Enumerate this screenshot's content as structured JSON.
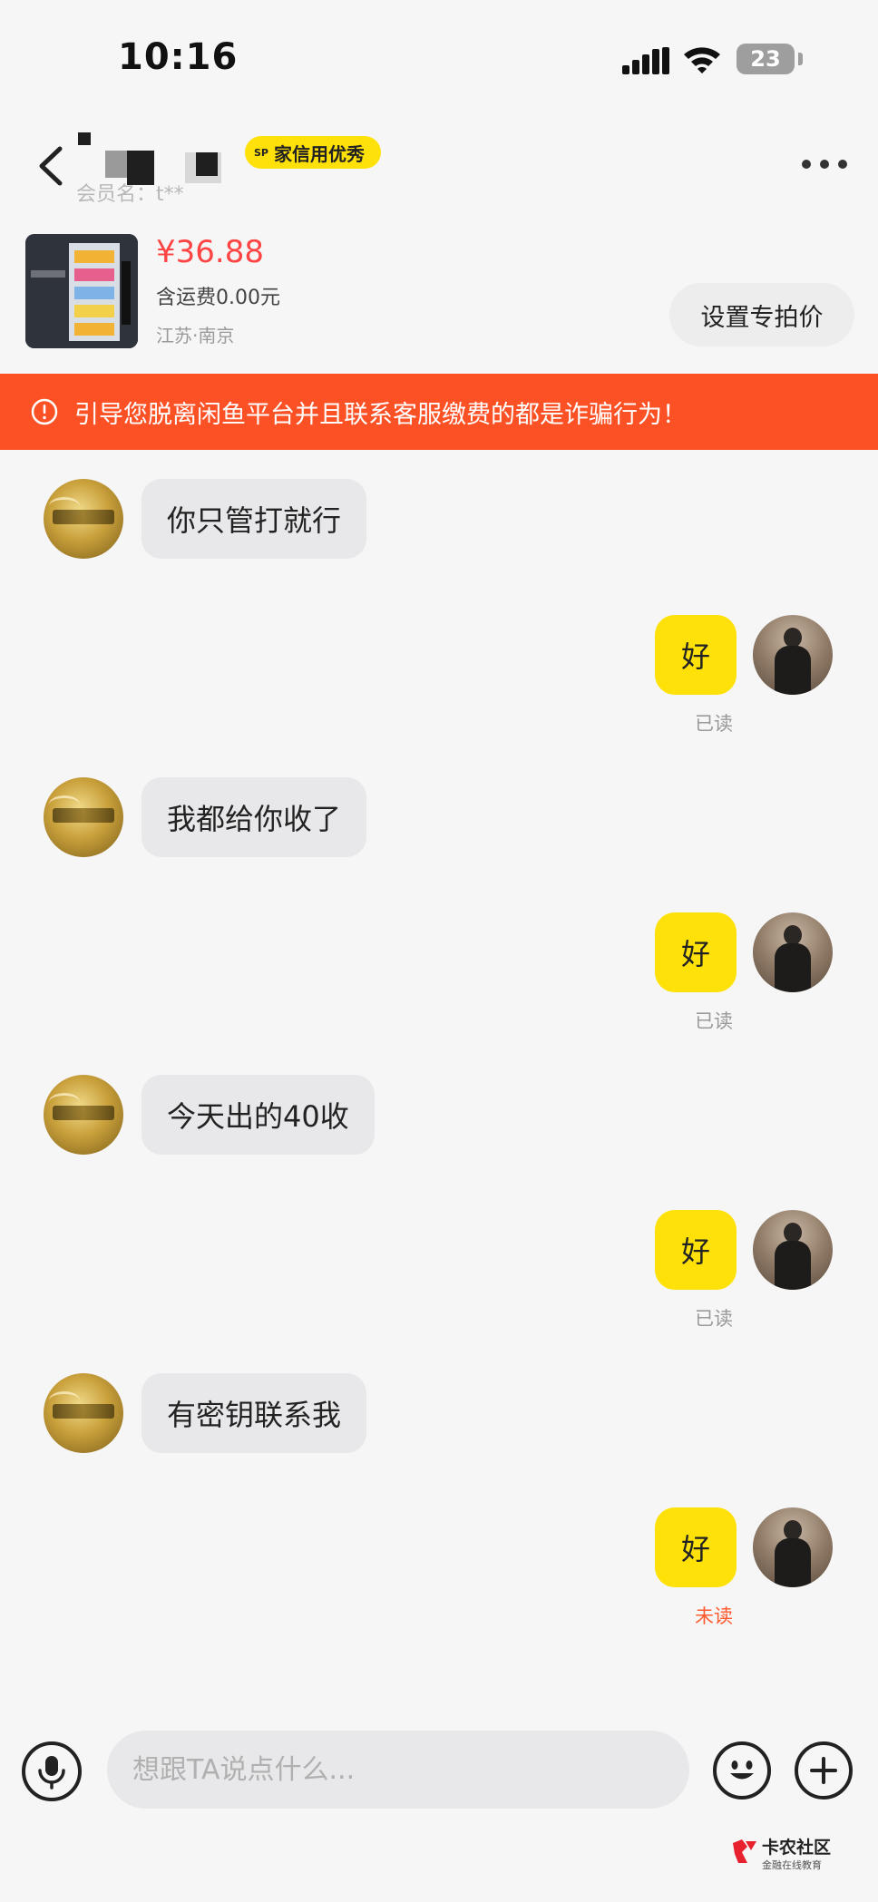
{
  "status_bar": {
    "time": "10:16",
    "battery": "23"
  },
  "header": {
    "credit_badge_sp": "SP",
    "credit_badge": "家信用优秀",
    "member_name": "会员名：t**"
  },
  "product": {
    "price": "¥36.88",
    "shipping": "含运费0.00元",
    "location": "江苏·南京",
    "special_price_button": "设置专拍价"
  },
  "warning": {
    "text": "引导您脱离闲鱼平台并且联系客服缴费的都是诈骗行为！"
  },
  "messages": [
    {
      "from": "other",
      "text": "你只管打就行"
    },
    {
      "from": "self",
      "text": "好",
      "status": "已读"
    },
    {
      "from": "other",
      "text": "我都给你收了"
    },
    {
      "from": "self",
      "text": "好",
      "status": "已读"
    },
    {
      "from": "other",
      "text": "今天出的40收"
    },
    {
      "from": "self",
      "text": "好",
      "status": "已读"
    },
    {
      "from": "other",
      "text": "有密钥联系我"
    },
    {
      "from": "self",
      "text": "好",
      "status": "未读"
    }
  ],
  "input": {
    "placeholder": "想跟TA说点什么..."
  },
  "watermark": {
    "title": "卡农社区",
    "subtitle": "金融在线教育"
  },
  "colors": {
    "accent_yellow": "#ffe10a",
    "warning_red": "#fb5125",
    "price_red": "#ff4444",
    "unread": "#ff5a30"
  }
}
